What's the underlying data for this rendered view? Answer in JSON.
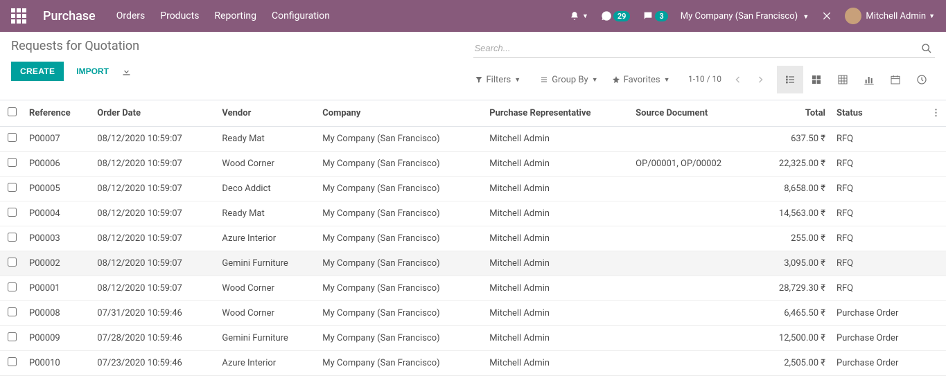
{
  "navbar": {
    "brand": "Purchase",
    "menu": [
      "Orders",
      "Products",
      "Reporting",
      "Configuration"
    ],
    "conversations_badge": "29",
    "messages_badge": "3",
    "company": "My Company (San Francisco)",
    "user": "Mitchell Admin"
  },
  "breadcrumb": "Requests for Quotation",
  "actions": {
    "create": "CREATE",
    "import": "IMPORT"
  },
  "search": {
    "placeholder": "Search...",
    "filters": "Filters",
    "group_by": "Group By",
    "favorites": "Favorites"
  },
  "pager": {
    "range": "1-10 / 10"
  },
  "columns": {
    "reference": "Reference",
    "order_date": "Order Date",
    "vendor": "Vendor",
    "company": "Company",
    "rep": "Purchase Representative",
    "source": "Source Document",
    "total": "Total",
    "status": "Status"
  },
  "rows": [
    {
      "ref": "P00007",
      "date": "08/12/2020 10:59:07",
      "vendor": "Ready Mat",
      "company": "My Company (San Francisco)",
      "rep": "Mitchell Admin",
      "source": "",
      "total": "637.50 ₹",
      "status": "RFQ"
    },
    {
      "ref": "P00006",
      "date": "08/12/2020 10:59:07",
      "vendor": "Wood Corner",
      "company": "My Company (San Francisco)",
      "rep": "Mitchell Admin",
      "source": "OP/00001, OP/00002",
      "total": "22,325.00 ₹",
      "status": "RFQ"
    },
    {
      "ref": "P00005",
      "date": "08/12/2020 10:59:07",
      "vendor": "Deco Addict",
      "company": "My Company (San Francisco)",
      "rep": "Mitchell Admin",
      "source": "",
      "total": "8,658.00 ₹",
      "status": "RFQ"
    },
    {
      "ref": "P00004",
      "date": "08/12/2020 10:59:07",
      "vendor": "Ready Mat",
      "company": "My Company (San Francisco)",
      "rep": "Mitchell Admin",
      "source": "",
      "total": "14,563.00 ₹",
      "status": "RFQ"
    },
    {
      "ref": "P00003",
      "date": "08/12/2020 10:59:07",
      "vendor": "Azure Interior",
      "company": "My Company (San Francisco)",
      "rep": "Mitchell Admin",
      "source": "",
      "total": "255.00 ₹",
      "status": "RFQ"
    },
    {
      "ref": "P00002",
      "date": "08/12/2020 10:59:07",
      "vendor": "Gemini Furniture",
      "company": "My Company (San Francisco)",
      "rep": "Mitchell Admin",
      "source": "",
      "total": "3,095.00 ₹",
      "status": "RFQ"
    },
    {
      "ref": "P00001",
      "date": "08/12/2020 10:59:07",
      "vendor": "Wood Corner",
      "company": "My Company (San Francisco)",
      "rep": "Mitchell Admin",
      "source": "",
      "total": "28,729.30 ₹",
      "status": "RFQ"
    },
    {
      "ref": "P00008",
      "date": "07/31/2020 10:59:46",
      "vendor": "Wood Corner",
      "company": "My Company (San Francisco)",
      "rep": "Mitchell Admin",
      "source": "",
      "total": "6,465.50 ₹",
      "status": "Purchase Order"
    },
    {
      "ref": "P00009",
      "date": "07/28/2020 10:59:46",
      "vendor": "Gemini Furniture",
      "company": "My Company (San Francisco)",
      "rep": "Mitchell Admin",
      "source": "",
      "total": "12,500.00 ₹",
      "status": "Purchase Order"
    },
    {
      "ref": "P00010",
      "date": "07/23/2020 10:59:46",
      "vendor": "Azure Interior",
      "company": "My Company (San Francisco)",
      "rep": "Mitchell Admin",
      "source": "",
      "total": "2,505.00 ₹",
      "status": "Purchase Order"
    }
  ],
  "highlight_row": 5
}
